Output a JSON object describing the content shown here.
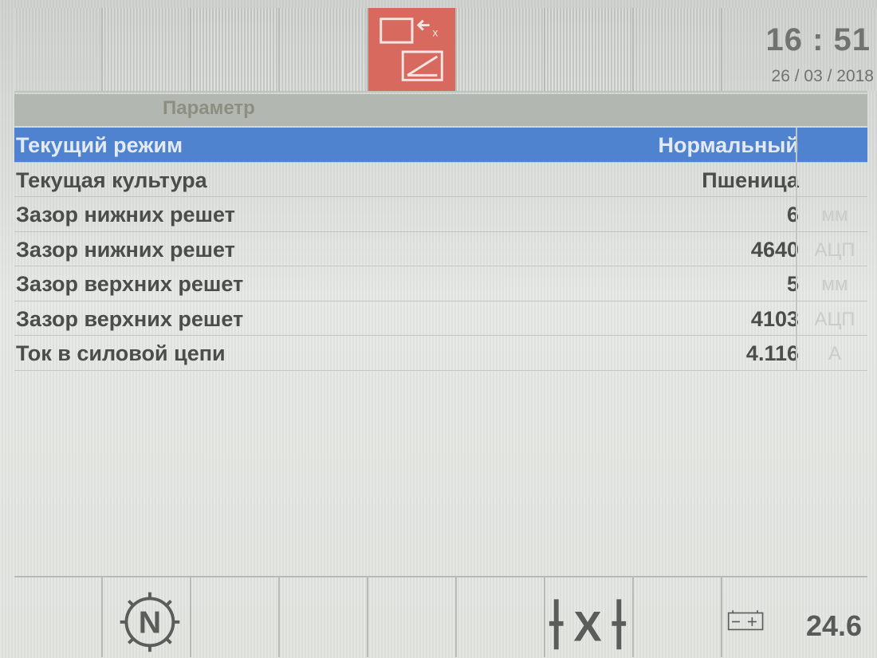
{
  "topbar": {
    "mode_icon": "screen-switch-icon",
    "time": "16 : 51",
    "date": "26 / 03 / 2018",
    "accent_color": "#d8695e"
  },
  "table": {
    "header": "Параметр",
    "rows": [
      {
        "name": "Текущий режим",
        "value": "Нормальный",
        "unit": ""
      },
      {
        "name": "Текущая культура",
        "value": "Пшеница",
        "unit": ""
      },
      {
        "name": "Зазор нижних решет",
        "value": "6",
        "unit": "мм"
      },
      {
        "name": "Зазор нижних решет",
        "value": "4640",
        "unit": "АЦП"
      },
      {
        "name": "Зазор верхних решет",
        "value": "5",
        "unit": "мм"
      },
      {
        "name": "Зазор верхних решет",
        "value": "4103",
        "unit": "АЦП"
      },
      {
        "name": "Ток в силовой цепи",
        "value": "4.116",
        "unit": "А"
      }
    ],
    "selected_color": "#4f83cf"
  },
  "bottombar": {
    "neutral_icon": "neutral-gear-icon",
    "x_icon": "x-axle-icon",
    "battery_icon": "battery-icon",
    "battery_voltage": "24.6"
  }
}
